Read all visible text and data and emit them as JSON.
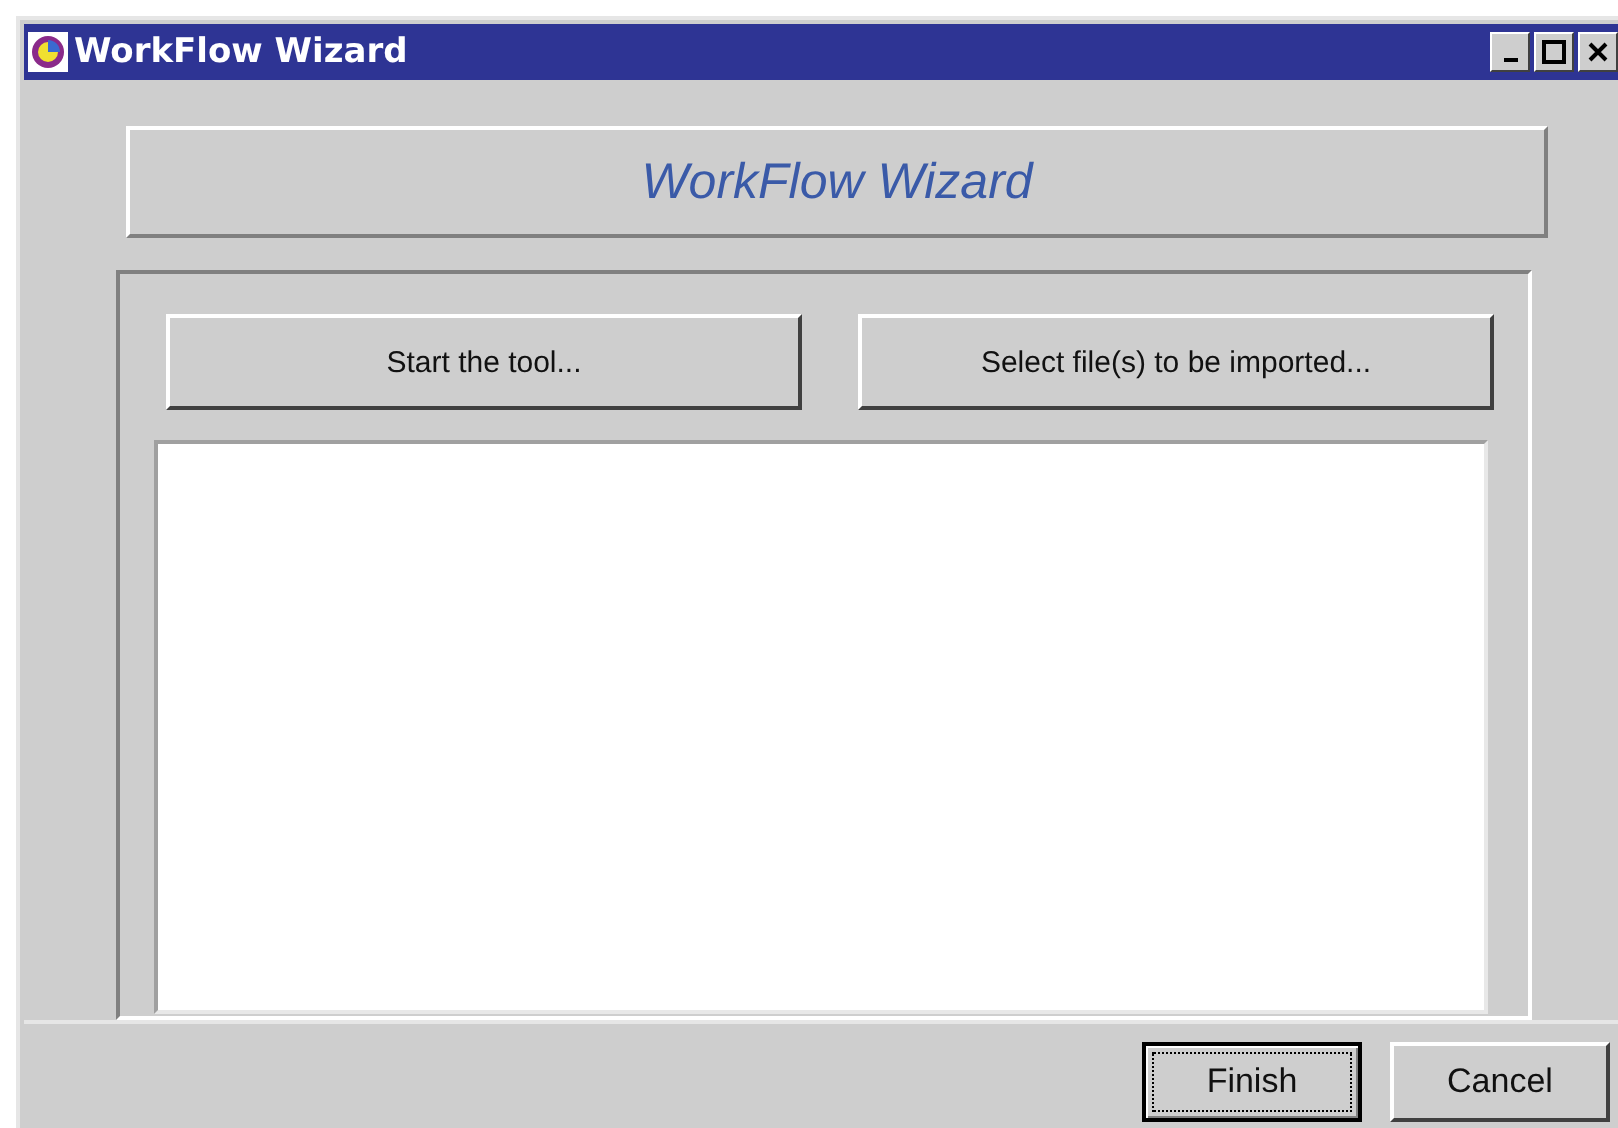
{
  "window": {
    "title": "WorkFlow Wizard"
  },
  "header": {
    "title": "WorkFlow Wizard"
  },
  "actions": [
    {
      "label": "Start the tool..."
    },
    {
      "label": "Select file(s) to be imported..."
    }
  ],
  "buttons": [
    {
      "label": "Finish",
      "focused": true
    },
    {
      "label": "Cancel",
      "focused": false
    }
  ]
}
